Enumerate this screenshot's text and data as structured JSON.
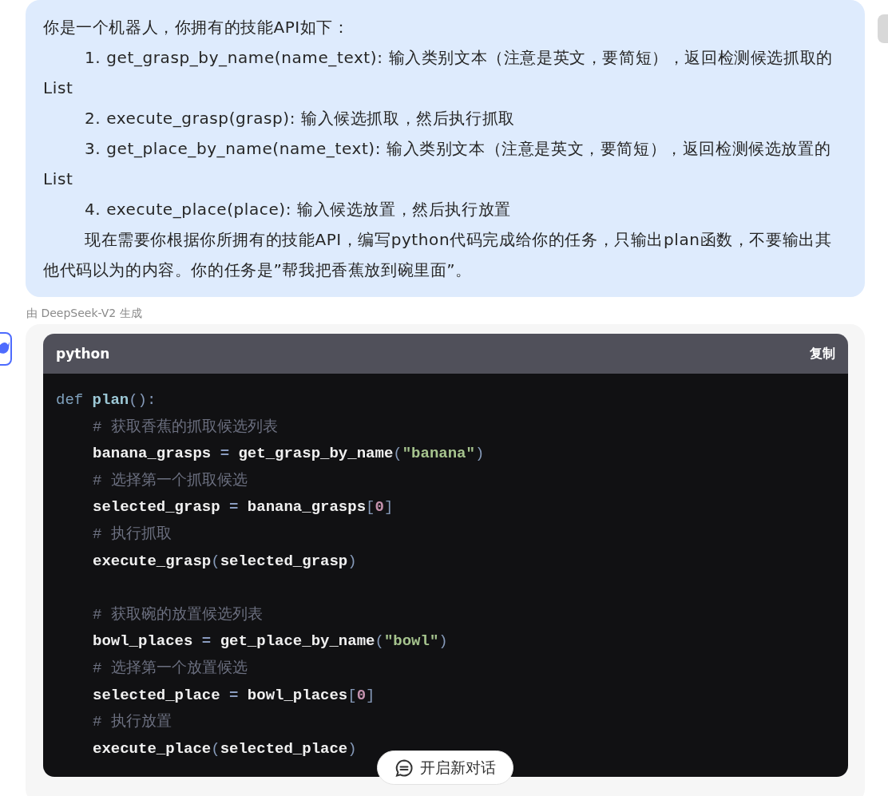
{
  "prompt": {
    "paragraphs": [
      {
        "kind": "plain",
        "text": "你是一个机器人，你拥有的技能API如下："
      },
      {
        "kind": "indented",
        "text": "1. get_grasp_by_name(name_text): 输入类别文本（注意是英文，要简短），返回检测候选抓取的List"
      },
      {
        "kind": "indented",
        "text": "2. execute_grasp(grasp): 输入候选抓取，然后执行抓取"
      },
      {
        "kind": "indented",
        "text": "3. get_place_by_name(name_text): 输入类别文本（注意是英文，要简短），返回检测候选放置的List"
      },
      {
        "kind": "indented",
        "text": "4. execute_place(place): 输入候选放置，然后执行放置"
      },
      {
        "kind": "indented",
        "text": "现在需要你根据你所拥有的技能API，编写python代码完成给你的任务，只输出plan函数，不要输出其他代码以为的内容。你的任务是”帮我把香蕉放到碗里面”。"
      }
    ]
  },
  "model_label": "由 DeepSeek-V2 生成",
  "code_block": {
    "language": "python",
    "copy_label": "复制",
    "lines": [
      {
        "tokens": [
          {
            "kind": "keyword",
            "text": "def"
          },
          {
            "kind": "func",
            "text": "plan"
          },
          {
            "kind": "punct",
            "text": "():"
          }
        ],
        "children": [
          {
            "tokens": [
              {
                "kind": "comment",
                "text": "# 获取香蕉的抓取候选列表"
              }
            ]
          },
          {
            "tokens": [
              {
                "kind": "plain",
                "text": "banana_grasps "
              },
              {
                "kind": "op",
                "text": "="
              },
              {
                "kind": "plain",
                "text": " get_grasp_by_name"
              },
              {
                "kind": "punct",
                "text": "("
              },
              {
                "kind": "string",
                "text": "\"banana\""
              },
              {
                "kind": "punct",
                "text": ")"
              }
            ]
          },
          {
            "tokens": [
              {
                "kind": "comment",
                "text": "# 选择第一个抓取候选"
              }
            ]
          },
          {
            "tokens": [
              {
                "kind": "plain",
                "text": "selected_grasp "
              },
              {
                "kind": "op",
                "text": "="
              },
              {
                "kind": "plain",
                "text": " banana_grasps"
              },
              {
                "kind": "punct",
                "text": "["
              },
              {
                "kind": "number",
                "text": "0"
              },
              {
                "kind": "punct",
                "text": "]"
              }
            ]
          },
          {
            "tokens": [
              {
                "kind": "comment",
                "text": "# 执行抓取"
              }
            ]
          },
          {
            "tokens": [
              {
                "kind": "plain",
                "text": "execute_grasp"
              },
              {
                "kind": "punct",
                "text": "("
              },
              {
                "kind": "plain",
                "text": "selected_grasp"
              },
              {
                "kind": "punct",
                "text": ")"
              }
            ]
          },
          {
            "kind": "blank"
          },
          {
            "tokens": [
              {
                "kind": "comment",
                "text": "# 获取碗的放置候选列表"
              }
            ]
          },
          {
            "tokens": [
              {
                "kind": "plain",
                "text": "bowl_places "
              },
              {
                "kind": "op",
                "text": "="
              },
              {
                "kind": "plain",
                "text": " get_place_by_name"
              },
              {
                "kind": "punct",
                "text": "("
              },
              {
                "kind": "string",
                "text": "\"bowl\""
              },
              {
                "kind": "punct",
                "text": ")"
              }
            ]
          },
          {
            "tokens": [
              {
                "kind": "comment",
                "text": "# 选择第一个放置候选"
              }
            ]
          },
          {
            "tokens": [
              {
                "kind": "plain",
                "text": "selected_place "
              },
              {
                "kind": "op",
                "text": "="
              },
              {
                "kind": "plain",
                "text": " bowl_places"
              },
              {
                "kind": "punct",
                "text": "["
              },
              {
                "kind": "number",
                "text": "0"
              },
              {
                "kind": "punct",
                "text": "]"
              }
            ]
          },
          {
            "tokens": [
              {
                "kind": "comment",
                "text": "# 执行放置"
              }
            ]
          },
          {
            "tokens": [
              {
                "kind": "plain",
                "text": "execute_place"
              },
              {
                "kind": "punct",
                "text": "("
              },
              {
                "kind": "plain",
                "text": "selected_place"
              },
              {
                "kind": "punct",
                "text": ")"
              }
            ]
          }
        ]
      }
    ]
  },
  "new_chat_button": {
    "label": "开启新对话"
  }
}
